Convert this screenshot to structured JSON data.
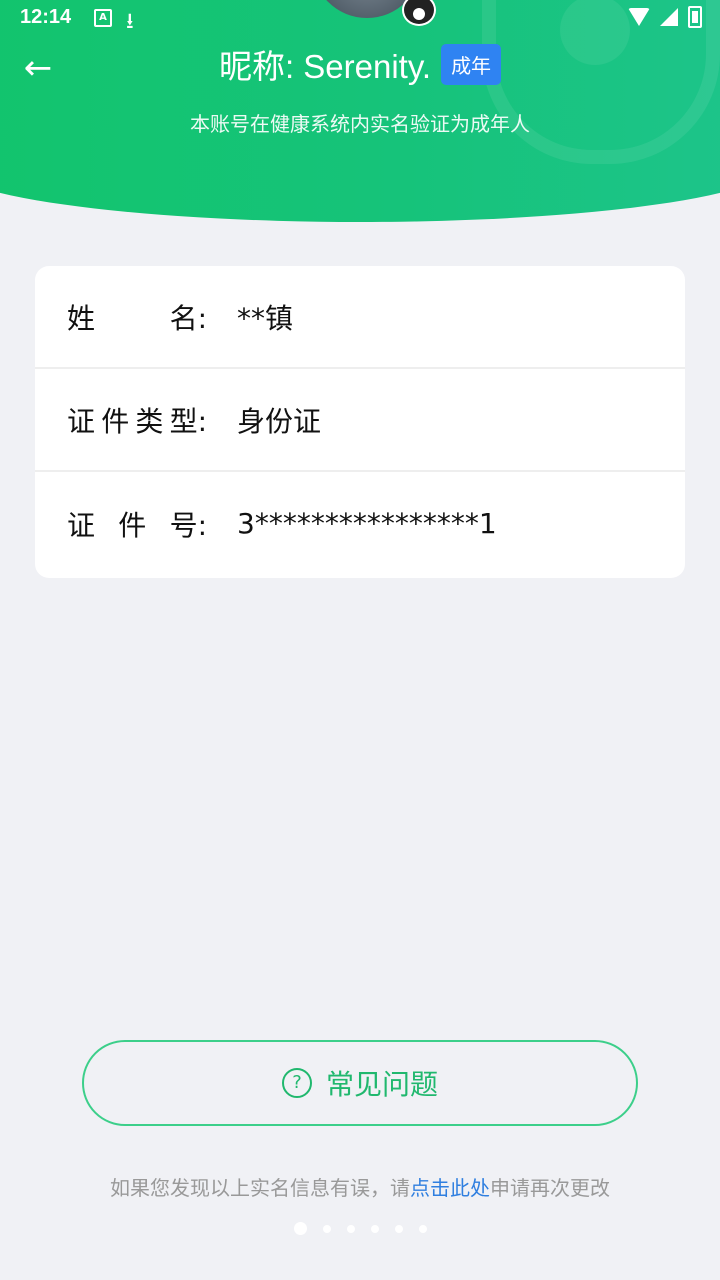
{
  "status_bar": {
    "time": "12:14",
    "icons": [
      "text-recognition-icon",
      "download-icon",
      "wifi-icon",
      "cell-signal-icon",
      "battery-charging-icon"
    ]
  },
  "header": {
    "nickname": "昵称: Serenity.",
    "badge": "成年",
    "subtitle": "本账号在健康系统内实名验证为成年人",
    "back_icon": "←",
    "colors": {
      "gradient_start": "#12c46c",
      "gradient_end": "#1ec48c",
      "badge": "#2f83f2"
    }
  },
  "info": {
    "rows": [
      {
        "label_chars": [
          "姓",
          "名:"
        ],
        "value": "**镇"
      },
      {
        "label_chars": [
          "证",
          "件",
          "类",
          "型:"
        ],
        "value": "身份证"
      },
      {
        "label_chars": [
          "证",
          "件",
          "号:"
        ],
        "value": "3****************1"
      }
    ]
  },
  "faq": {
    "icon": "?",
    "label": "常见问题",
    "color": "#20b86e"
  },
  "footer": {
    "prefix": "如果您发现以上实名信息有误，请",
    "link": "点击此处",
    "suffix": "申请再次更改",
    "link_color": "#2f7fe0"
  },
  "pager": {
    "count": 6,
    "active_index": 0
  }
}
